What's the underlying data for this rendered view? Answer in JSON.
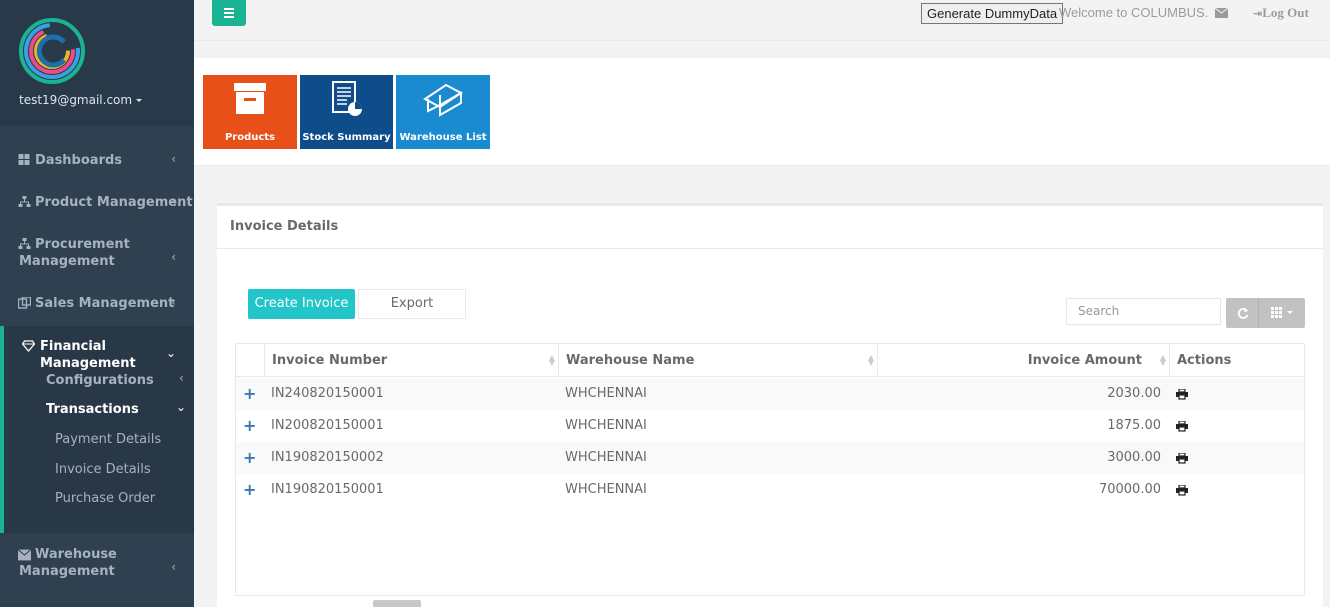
{
  "topbar": {
    "generate_label": "Generate DummyData",
    "welcome": "Welcome to COLUMBUS.",
    "logout": "Log Out"
  },
  "profile": {
    "email": "test19@gmail.com"
  },
  "sidebar": {
    "items": [
      {
        "label": "Dashboards",
        "icon": "dashboard-icon"
      },
      {
        "label": "Product Management",
        "icon": "sitemap-icon"
      },
      {
        "label": "Procurement",
        "label2": "Management",
        "icon": "sitemap-icon"
      },
      {
        "label": "Sales Management",
        "icon": "sales-icon"
      },
      {
        "label": "Financial Management",
        "icon": "diamond-icon"
      },
      {
        "label": "Warehouse",
        "label2": "Management",
        "icon": "envelope-icon"
      }
    ],
    "sub": {
      "configurations": "Configurations",
      "transactions": "Transactions",
      "payment_details": "Payment Details",
      "invoice_details": "Invoice Details",
      "purchase_order": "Purchase Order"
    }
  },
  "tiles": [
    {
      "label": "Products",
      "color": "#e8501a"
    },
    {
      "label": "Stock Summary",
      "color": "#0f4c8a"
    },
    {
      "label": "Warehouse List",
      "color": "#1a8bd1"
    }
  ],
  "panel": {
    "title": "Invoice Details",
    "create_label": "Create Invoice",
    "export_label": "Export",
    "search_placeholder": "Search"
  },
  "table": {
    "columns": [
      "Invoice Number",
      "Warehouse Name",
      "Invoice Amount",
      "Actions"
    ],
    "rows": [
      {
        "number": "IN240820150001",
        "warehouse": "WHCHENNAI",
        "amount": "2030.00"
      },
      {
        "number": "IN200820150001",
        "warehouse": "WHCHENNAI",
        "amount": "1875.00"
      },
      {
        "number": "IN190820150002",
        "warehouse": "WHCHENNAI",
        "amount": "3000.00"
      },
      {
        "number": "IN190820150001",
        "warehouse": "WHCHENNAI",
        "amount": "70000.00"
      }
    ]
  },
  "colors": {
    "accent": "#1ab394",
    "info": "#23c6c8",
    "sidebar": "#2f4050"
  }
}
